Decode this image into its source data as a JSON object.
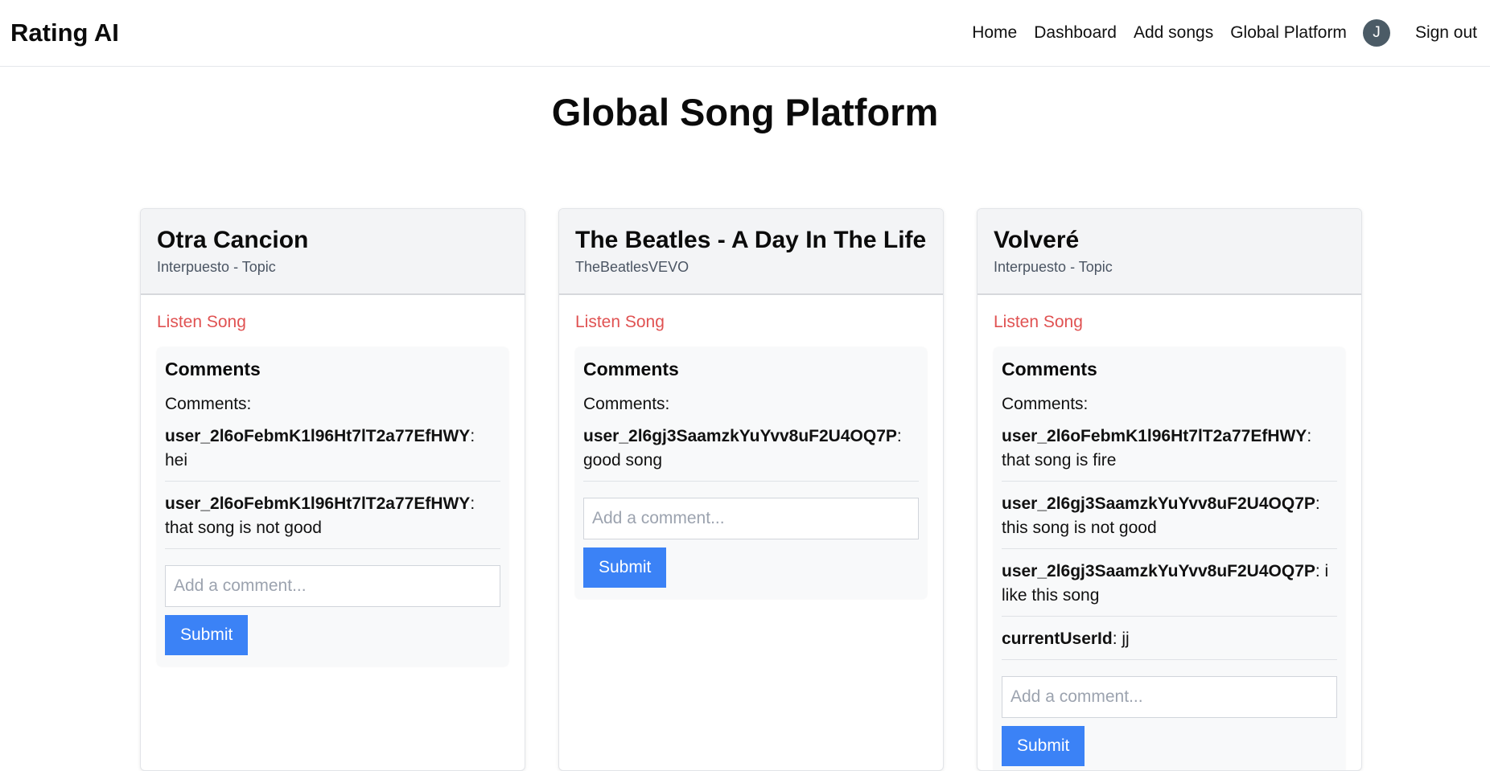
{
  "nav": {
    "brand": "Rating AI",
    "links": [
      "Home",
      "Dashboard",
      "Add songs",
      "Global Platform"
    ],
    "avatar_initial": "J",
    "signout": "Sign out"
  },
  "page": {
    "title": "Global Song Platform"
  },
  "colors": {
    "accent": "#3b82f6",
    "listen_link": "#e05252",
    "card_header_bg": "#f3f4f6",
    "avatar_bg": "#4b5b66"
  },
  "cards": [
    {
      "title": "Otra Cancion",
      "artist": "Interpuesto - Topic",
      "listen_label": "Listen Song",
      "comments_heading": "Comments",
      "comments_label": "Comments:",
      "comments": [
        {
          "user": "user_2l6oFebmK1l96Ht7lT2a77EfHWY",
          "text": ": hei"
        },
        {
          "user": "user_2l6oFebmK1l96Ht7lT2a77EfHWY",
          "text": ": that song is not good"
        }
      ],
      "input_placeholder": "Add a comment...",
      "submit_label": "Submit"
    },
    {
      "title": "The Beatles - A Day In The Life",
      "artist": "TheBeatlesVEVO",
      "listen_label": "Listen Song",
      "comments_heading": "Comments",
      "comments_label": "Comments:",
      "comments": [
        {
          "user": "user_2l6gj3SaamzkYuYvv8uF2U4OQ7P",
          "text": ": good song"
        }
      ],
      "input_placeholder": "Add a comment...",
      "submit_label": "Submit"
    },
    {
      "title": "Volveré",
      "artist": "Interpuesto - Topic",
      "listen_label": "Listen Song",
      "comments_heading": "Comments",
      "comments_label": "Comments:",
      "comments": [
        {
          "user": "user_2l6oFebmK1l96Ht7lT2a77EfHWY",
          "text": ": that song is fire"
        },
        {
          "user": "user_2l6gj3SaamzkYuYvv8uF2U4OQ7P",
          "text": ": this song is not good"
        },
        {
          "user": "user_2l6gj3SaamzkYuYvv8uF2U4OQ7P",
          "text": ": i like this song"
        },
        {
          "user": "currentUserId",
          "text": ": jj"
        }
      ],
      "input_placeholder": "Add a comment...",
      "submit_label": "Submit"
    }
  ]
}
